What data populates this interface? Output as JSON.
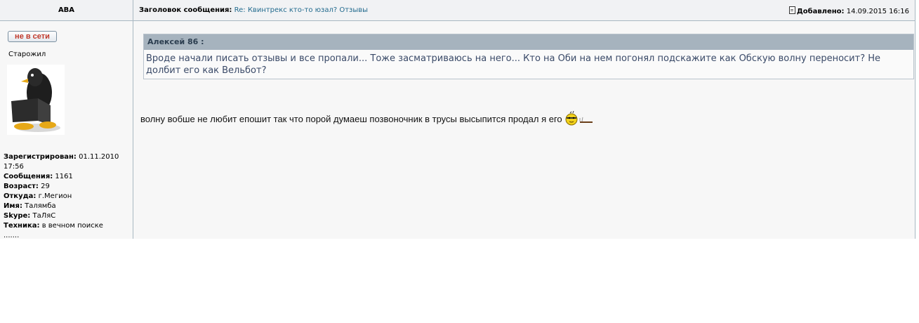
{
  "header": {
    "author": "ABA",
    "subject_label": "Заголовок сообщения:",
    "subject_value": "Re: Квинтрекс кто-то юзал? Отзывы",
    "date_label": "Добавлено:",
    "date_value": "14.09.2015 16:16"
  },
  "sidebar": {
    "status_button": "не в сети",
    "rank": "Старожил",
    "avatar_icon": "penguin-with-laptop-icon",
    "profile": [
      {
        "label": "Зарегистрирован:",
        "value": "01.11.2010 17:56"
      },
      {
        "label": "Сообщения:",
        "value": "1161"
      },
      {
        "label": "Возраст:",
        "value": "29"
      },
      {
        "label": "Откуда:",
        "value": "г.Мегион"
      },
      {
        "label": "Имя:",
        "value": "Талямба"
      },
      {
        "label": "Skype:",
        "value": "ТаЛяС"
      },
      {
        "label": "Техника:",
        "value": "в вечном поиске"
      }
    ],
    "trailing": "......."
  },
  "post": {
    "quote_author": "Алексей 86 :",
    "quote_text": "Вроде начали писать отзывы и все пропали... Тоже засматриваюсь на него... Кто на Оби на нем погонял подскажите как Обскую волну переносит? Не долбит его как Вельбот?",
    "message": "волну вобше не любит епошит так что порой думаеш позвоночник в трусы высыпится продал я его",
    "emoticon_icon": "smoking-smiley-icon"
  },
  "colors": {
    "border": "#a9b8c2",
    "quote_header": "#a6b3be",
    "link": "#236b8e",
    "offline": "#c0392b"
  }
}
